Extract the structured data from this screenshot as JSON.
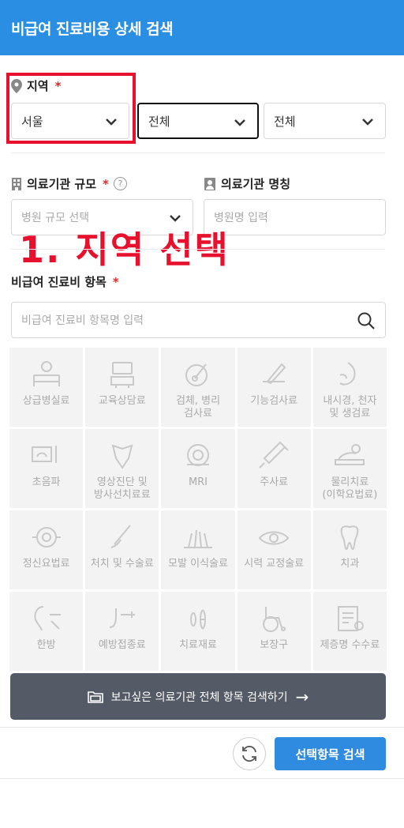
{
  "header": {
    "title": "비급여 진료비용 상세 검색"
  },
  "region": {
    "label": "지역",
    "required_mark": "*",
    "select1": "서울",
    "select2": "전체",
    "select3": "전체"
  },
  "institution": {
    "scale_label": "의료기관 규모",
    "required_mark": "*",
    "help_glyph": "?",
    "scale_placeholder": "병원 규모 선택",
    "name_label": "의료기관 명칭",
    "name_placeholder": "병원명 입력"
  },
  "annotation": "1. 지역 선택",
  "items": {
    "label": "비급여 진료비 항목",
    "required_mark": "*",
    "search_placeholder": "비급여 진료비 항목명 입력",
    "tiles": [
      {
        "label": "상급병실료",
        "icon": "hospital-bed-icon"
      },
      {
        "label": "교육상담료",
        "icon": "consultation-icon"
      },
      {
        "label": "검체, 병리\n검사료",
        "icon": "specimen-icon"
      },
      {
        "label": "기능검사료",
        "icon": "function-test-icon"
      },
      {
        "label": "내시경, 천자\n및 생검료",
        "icon": "endoscope-icon"
      },
      {
        "label": "초음파",
        "icon": "ultrasound-icon"
      },
      {
        "label": "영상진단 및\n방사선치료료",
        "icon": "radiology-icon"
      },
      {
        "label": "MRI",
        "icon": "mri-icon"
      },
      {
        "label": "주사료",
        "icon": "syringe-icon"
      },
      {
        "label": "물리치료\n(이학요법료)",
        "icon": "physio-icon"
      },
      {
        "label": "정신요법료",
        "icon": "brain-icon"
      },
      {
        "label": "처치 및 수술료",
        "icon": "surgery-icon"
      },
      {
        "label": "모발 이식술료",
        "icon": "hair-transplant-icon"
      },
      {
        "label": "시력 교정술료",
        "icon": "eye-icon"
      },
      {
        "label": "치과",
        "icon": "tooth-icon"
      },
      {
        "label": "한방",
        "icon": "acupuncture-icon"
      },
      {
        "label": "예방접종료",
        "icon": "vaccine-icon"
      },
      {
        "label": "치료재료",
        "icon": "material-icon"
      },
      {
        "label": "보장구",
        "icon": "wheelchair-icon"
      },
      {
        "label": "제증명 수수료",
        "icon": "certificate-icon"
      }
    ]
  },
  "buttons": {
    "full_search": "보고싶은 의료기관 전체 항목 검색하기",
    "full_search_arrow": "→",
    "selected_search": "선택항목 검색"
  },
  "colors": {
    "header": "#2a8fe3",
    "highlight": "#e8112d",
    "dark_button": "#555b66",
    "primary_button": "#2f8be0"
  }
}
